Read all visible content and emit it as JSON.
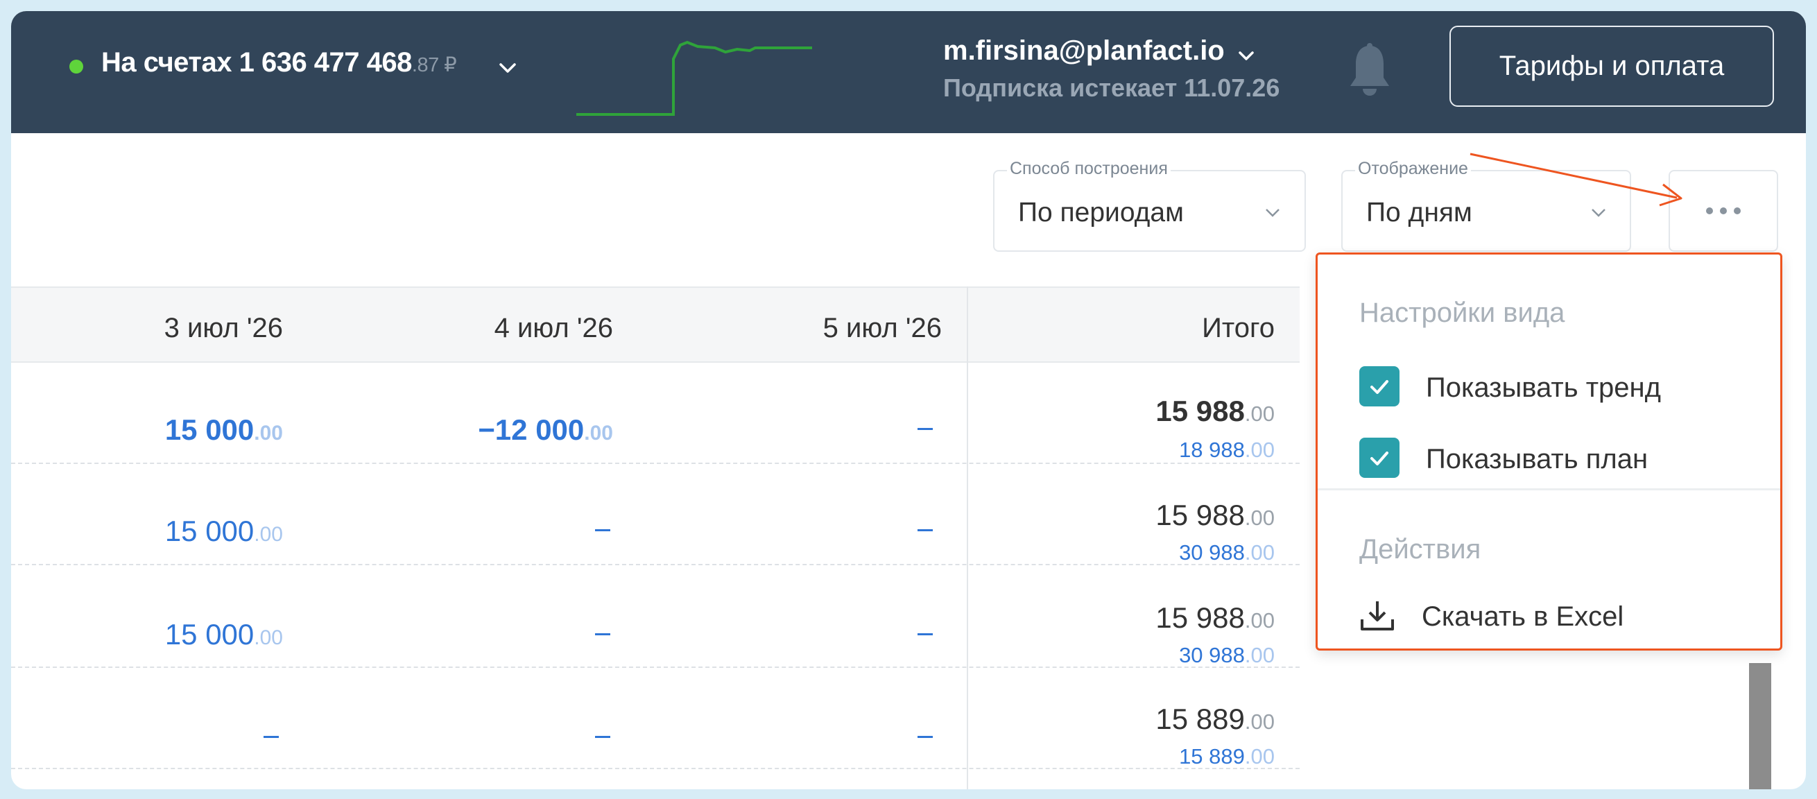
{
  "header": {
    "balance_label": "На счетах 1 636 477 468",
    "balance_cents": ".87 ₽",
    "user_email": "m.firsina@planfact.io",
    "subscription_text": "Подписка истекает 11.07.26",
    "tariffs_button": "Тарифы и оплата"
  },
  "filters": {
    "method_legend": "Способ построения",
    "method_value": "По периодам",
    "display_legend": "Отображение",
    "display_value": "По дням"
  },
  "table": {
    "columns": [
      "3 июл '26",
      "4 июл '26",
      "5 июл '26",
      "Итого"
    ],
    "rows": [
      {
        "c1": "15 000",
        "c1_cents": ".00",
        "c2": "−12 000",
        "c2_cents": ".00",
        "c3": "–",
        "total": "15 988",
        "total_cents": ".00",
        "plan": "18 988",
        "plan_cents": ".00"
      },
      {
        "c1": "15 000",
        "c1_cents": ".00",
        "c2": "–",
        "c3": "–",
        "total": "15 988",
        "total_cents": ".00",
        "plan": "30 988",
        "plan_cents": ".00"
      },
      {
        "c1": "15 000",
        "c1_cents": ".00",
        "c2": "–",
        "c3": "–",
        "total": "15 988",
        "total_cents": ".00",
        "plan": "30 988",
        "plan_cents": ".00"
      },
      {
        "c1": "–",
        "c2": "–",
        "c3": "–",
        "total": "15 889",
        "total_cents": ".00",
        "plan": "15 889",
        "plan_cents": ".00"
      }
    ]
  },
  "menu": {
    "section_view": "Настройки вида",
    "show_trend": "Показывать тренд",
    "show_trend_checked": true,
    "show_plan": "Показывать план",
    "show_plan_checked": true,
    "section_actions": "Действия",
    "export_excel": "Скачать в Excel"
  },
  "colors": {
    "header_bg": "#324559",
    "accent_blue": "#2f75d6",
    "checkbox": "#2aa0ab",
    "highlight": "#ee5520",
    "status_green": "#5fd43b"
  },
  "icons": [
    "status-dot-icon",
    "chevron-down-icon",
    "trend-sparkline-icon",
    "bell-icon",
    "more-dots-icon",
    "check-icon",
    "download-icon",
    "arrow-annotation-icon"
  ]
}
